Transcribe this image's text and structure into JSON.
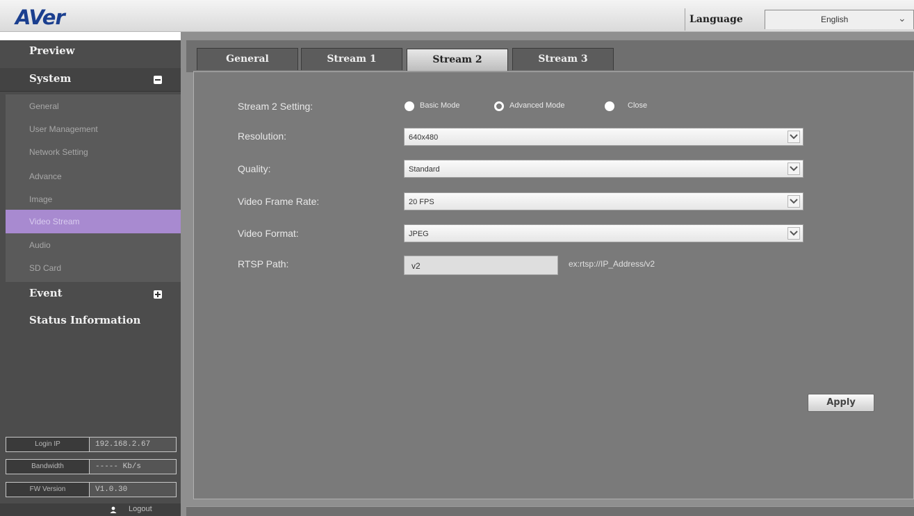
{
  "header": {
    "logo_text": "AVer",
    "language_label": "Language",
    "language_value": "English"
  },
  "sidebar": {
    "preview": "Preview",
    "system": "System",
    "sub_items": [
      "General",
      "User Management",
      "Network Setting",
      "Advance",
      "Image",
      "Video Stream",
      "Audio",
      "SD Card"
    ],
    "active_item": "Video Stream",
    "event": "Event",
    "status_information": "Status Information",
    "info": {
      "login_ip_label": "Login IP",
      "login_ip_value": "192.168.2.67",
      "bandwidth_label": "Bandwidth",
      "bandwidth_value": "----- Kb/s",
      "fw_version_label": "FW Version",
      "fw_version_value": "V1.0.30"
    },
    "logout": "Logout"
  },
  "tabs": [
    "General",
    "Stream 1",
    "Stream 2",
    "Stream 3"
  ],
  "active_tab": "Stream 2",
  "form": {
    "stream_setting_label": "Stream 2 Setting:",
    "modes": [
      "Basic Mode",
      "Advanced Mode",
      "Close"
    ],
    "selected_mode": "Advanced Mode",
    "resolution_label": "Resolution:",
    "resolution_value": "640x480",
    "quality_label": "Quality:",
    "quality_value": "Standard",
    "frame_rate_label": "Video Frame Rate:",
    "frame_rate_value": "20 FPS",
    "format_label": "Video Format:",
    "format_value": "JPEG",
    "rtsp_label": "RTSP Path:",
    "rtsp_value": "v2",
    "rtsp_hint": "ex:rtsp://IP_Address/v2"
  },
  "apply_label": "Apply",
  "colors": {
    "active_menu": "#a88ad0",
    "logo": "#1b3f8f"
  }
}
